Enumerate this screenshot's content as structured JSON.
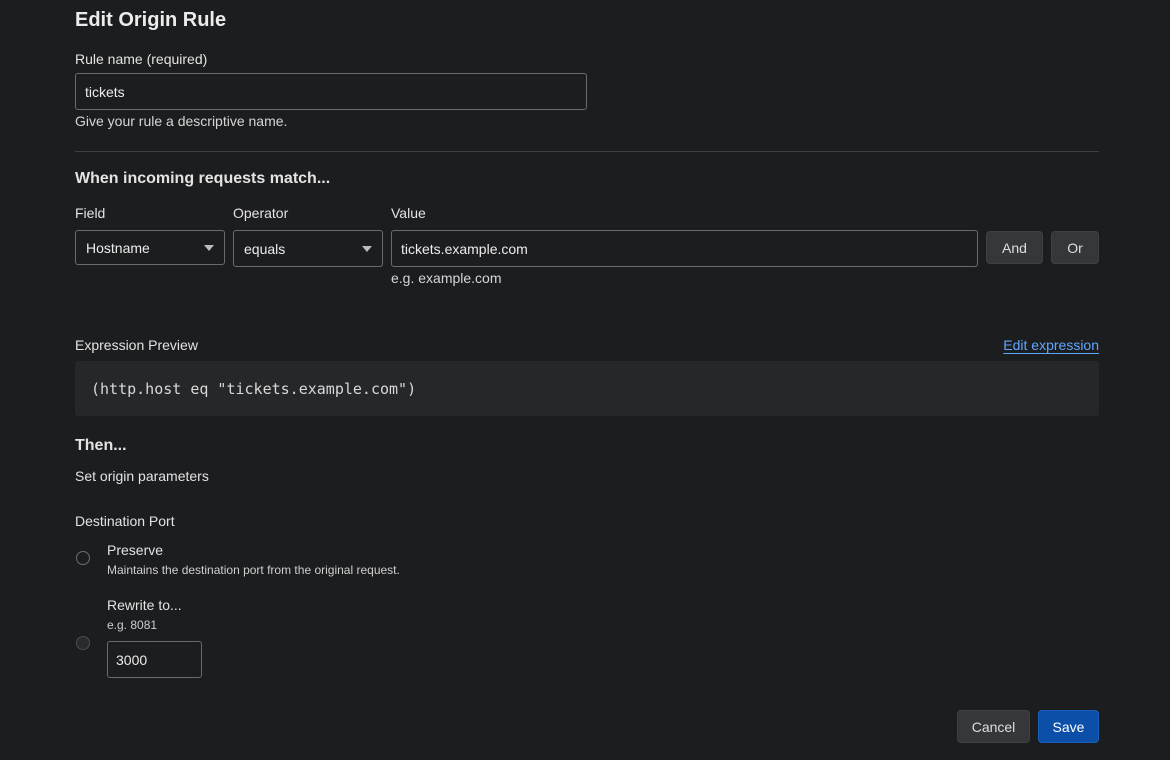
{
  "page": {
    "title": "Edit Origin Rule"
  },
  "rule_name": {
    "label": "Rule name (required)",
    "value": "tickets",
    "help": "Give your rule a descriptive name."
  },
  "match": {
    "heading": "When incoming requests match...",
    "field_label": "Field",
    "operator_label": "Operator",
    "value_label": "Value",
    "field_value": "Hostname",
    "operator_value": "equals",
    "value_value": "tickets.example.com",
    "value_hint": "e.g. example.com",
    "and_label": "And",
    "or_label": "Or"
  },
  "expression": {
    "label": "Expression Preview",
    "edit_link": "Edit expression",
    "code": "(http.host eq \"tickets.example.com\")"
  },
  "then": {
    "heading": "Then...",
    "subheading": "Set origin parameters",
    "port_label": "Destination Port",
    "preserve_label": "Preserve",
    "preserve_desc": "Maintains the destination port from the original request.",
    "rewrite_label": "Rewrite to...",
    "rewrite_hint": "e.g. 8081",
    "rewrite_value": "3000"
  },
  "actions": {
    "cancel": "Cancel",
    "save": "Save"
  },
  "colors": {
    "accent": "#0b4fa8",
    "link": "#5fa6ff",
    "background": "#1c1d1f"
  }
}
